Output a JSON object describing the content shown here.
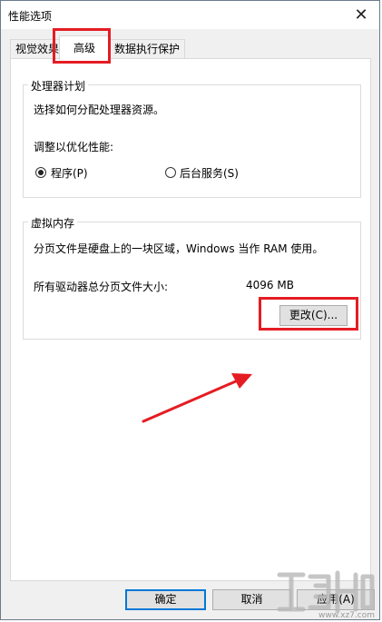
{
  "window": {
    "title": "性能选项",
    "close_glyph": "✕"
  },
  "tabs": [
    {
      "label": "视觉效果"
    },
    {
      "label": "高级"
    },
    {
      "label": "数据执行保护"
    }
  ],
  "processor": {
    "legend": "处理器计划",
    "desc": "选择如何分配处理器资源。",
    "adjust_label": "调整以优化性能:",
    "option_programs": "程序(P)",
    "option_services": "后台服务(S)",
    "selected": "programs"
  },
  "virtual_memory": {
    "legend": "虚拟内存",
    "desc": "分页文件是硬盘上的一块区域，Windows 当作 RAM 使用。",
    "total_label": "所有驱动器总分页文件大小:",
    "total_value": "4096 MB",
    "change_button": "更改(C)..."
  },
  "footer": {
    "ok": "确定",
    "cancel": "取消",
    "apply": "应用(A)"
  },
  "annotations": {
    "highlight_color": "#e51c23"
  },
  "watermark": {
    "text": "www.xz7.com"
  }
}
